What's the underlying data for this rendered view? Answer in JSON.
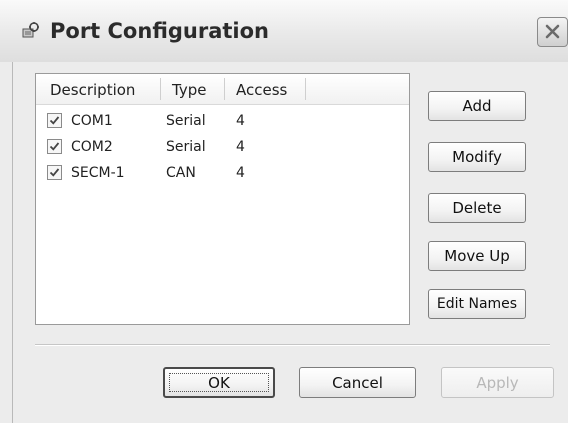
{
  "window": {
    "title": "Port Configuration"
  },
  "list": {
    "columns": [
      "Description",
      "Type",
      "Access"
    ],
    "rows": [
      {
        "description": "COM1",
        "type": "Serial",
        "access": "4",
        "checked": true
      },
      {
        "description": "COM2",
        "type": "Serial",
        "access": "4",
        "checked": true
      },
      {
        "description": "SECM-1",
        "type": "CAN",
        "access": "4",
        "checked": true
      }
    ]
  },
  "side_buttons": {
    "add": "Add",
    "modify": "Modify",
    "delete": "Delete",
    "move_up": "Move Up",
    "edit_names": "Edit Names"
  },
  "footer_buttons": {
    "ok": "OK",
    "cancel": "Cancel",
    "apply": "Apply"
  },
  "icons": {
    "title": "port-config-icon",
    "close": "close-icon",
    "check": "checkmark-icon"
  }
}
